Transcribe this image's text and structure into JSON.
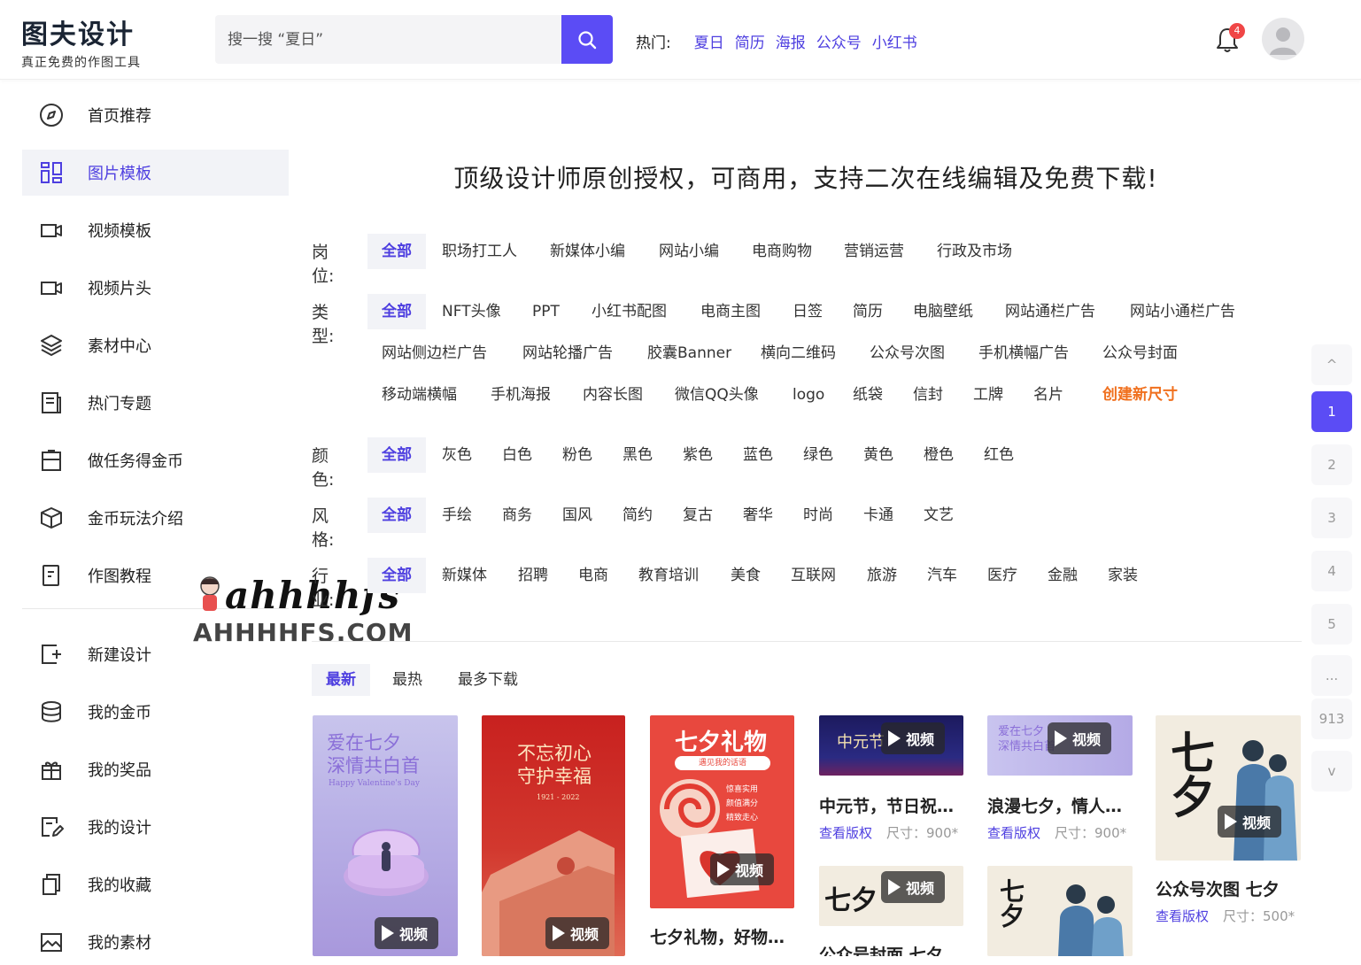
{
  "header": {
    "logo_name": "图夫设计",
    "logo_slogan": "真正免费的作图工具",
    "search_placeholder": "搜一搜 “夏日”",
    "hot_label": "热门:",
    "hot_keywords": [
      "夏日",
      "简历",
      "海报",
      "公众号",
      "小红书"
    ],
    "notification_count": "4"
  },
  "sidebar": {
    "items": [
      {
        "label": "首页推荐",
        "icon": "compass-icon"
      },
      {
        "label": "图片模板",
        "icon": "image-template-icon"
      },
      {
        "label": "视频模板",
        "icon": "video-icon"
      },
      {
        "label": "视频片头",
        "icon": "video-intro-icon"
      },
      {
        "label": "素材中心",
        "icon": "layers-icon"
      },
      {
        "label": "热门专题",
        "icon": "topic-icon"
      },
      {
        "label": "做任务得金币",
        "icon": "task-icon"
      },
      {
        "label": "金币玩法介绍",
        "icon": "box-icon"
      },
      {
        "label": "作图教程",
        "icon": "tutorial-icon"
      }
    ],
    "items2": [
      {
        "label": "新建设计",
        "icon": "new-design-icon"
      },
      {
        "label": "我的金币",
        "icon": "coins-icon"
      },
      {
        "label": "我的奖品",
        "icon": "gift-icon"
      },
      {
        "label": "我的设计",
        "icon": "my-design-icon"
      },
      {
        "label": "我的收藏",
        "icon": "collection-icon"
      },
      {
        "label": "我的素材",
        "icon": "my-material-icon"
      }
    ]
  },
  "watermark": {
    "script": "ahhhhfs",
    "domain": "AHHHHFS.COM"
  },
  "main": {
    "headline": "顶级设计师原创授权，可商用，支持二次在线编辑及免费下载!",
    "filters": {
      "position": {
        "label": "岗位:",
        "options": [
          "全部",
          "职场打工人",
          "新媒体小编",
          "网站小编",
          "电商购物",
          "营销运营",
          "行政及市场"
        ]
      },
      "type": {
        "label": "类型:",
        "options": [
          "全部",
          "NFT头像",
          "PPT",
          "小红书配图",
          "电商主图",
          "日签",
          "简历",
          "电脑壁纸",
          "网站通栏广告",
          "网站小通栏广告",
          "网站侧边栏广告",
          "网站轮播广告",
          "胶囊Banner",
          "横向二维码",
          "公众号次图",
          "手机横幅广告",
          "公众号封面",
          "移动端横幅",
          "手机海报",
          "内容长图",
          "微信QQ头像",
          "logo",
          "纸袋",
          "信封",
          "工牌",
          "名片",
          "创建新尺寸"
        ]
      },
      "color": {
        "label": "颜色:",
        "options": [
          "全部",
          "灰色",
          "白色",
          "粉色",
          "黑色",
          "紫色",
          "蓝色",
          "绿色",
          "黄色",
          "橙色",
          "红色"
        ]
      },
      "style": {
        "label": "风格:",
        "options": [
          "全部",
          "手绘",
          "商务",
          "国风",
          "简约",
          "复古",
          "奢华",
          "时尚",
          "卡通",
          "文艺"
        ]
      },
      "industry": {
        "label": "行业:",
        "options": [
          "全部",
          "新媒体",
          "招聘",
          "电商",
          "教育培训",
          "美食",
          "互联网",
          "旅游",
          "汽车",
          "医疗",
          "金融",
          "家装"
        ]
      }
    },
    "sort_tabs": [
      "最新",
      "最热",
      "最多下载"
    ],
    "video_badge": "视频",
    "license_label": "查看版权",
    "cards": [
      {
        "poster": "爱在七夕\n深情共白首",
        "sub": "Happy Valentine's Day"
      },
      {
        "poster": "不忘初心\n守护幸福",
        "sub": "1921 - 2022"
      },
      {
        "poster": "七夕礼物",
        "sub": "遇见我的话语",
        "title": "七夕礼物，好物…"
      },
      {
        "poster": "中元节",
        "title": "中元节，节日祝…",
        "size": "尺寸：900*"
      },
      {
        "poster": "爱在七夕\n深情共白首",
        "title": "浪漫七夕，情人…",
        "size": "尺寸：900*"
      },
      {
        "poster": "七夕",
        "title": "公众号次图 七夕",
        "size": "尺寸：500*"
      },
      {
        "poster": "七夕",
        "title": "公众号封面 七夕"
      },
      {
        "poster": "七夕"
      }
    ],
    "gift_list": [
      "惊喜实用",
      "颜值满分",
      "精致走心"
    ]
  },
  "pager": {
    "up": "^",
    "pages": [
      "1",
      "2",
      "3",
      "4",
      "5",
      "...",
      "913"
    ],
    "down": "v"
  },
  "colors": {
    "accent": "#5b4cf5",
    "link": "#4e3fe0",
    "orange": "#f0701e",
    "badge": "#f04646"
  }
}
